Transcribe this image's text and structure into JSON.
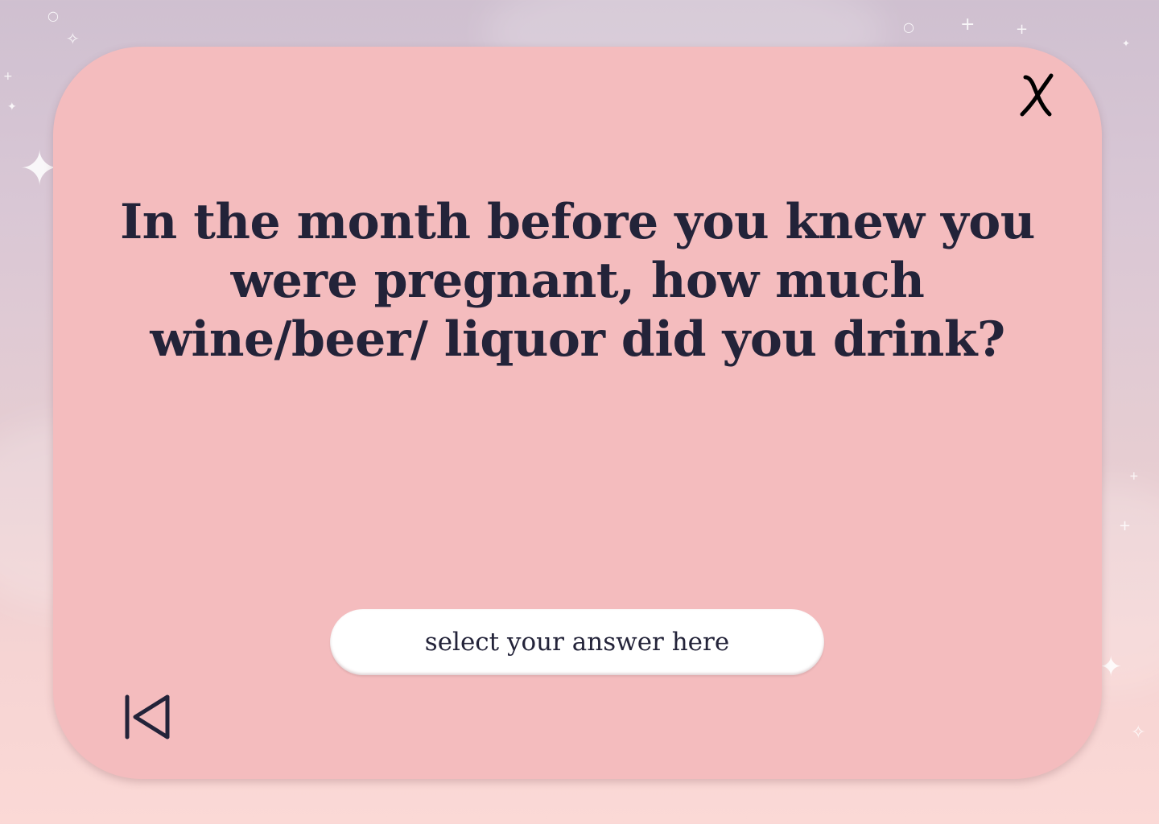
{
  "question": {
    "text": "In the month before you knew you were pregnant, how much wine/beer/ liquor did you drink?"
  },
  "answer": {
    "placeholder": "select your answer here"
  },
  "icons": {
    "close": "close-icon",
    "back": "skip-back-icon"
  },
  "colors": {
    "card": "#f4bcbe",
    "text": "#232339",
    "answer_bg": "#ffffff"
  }
}
